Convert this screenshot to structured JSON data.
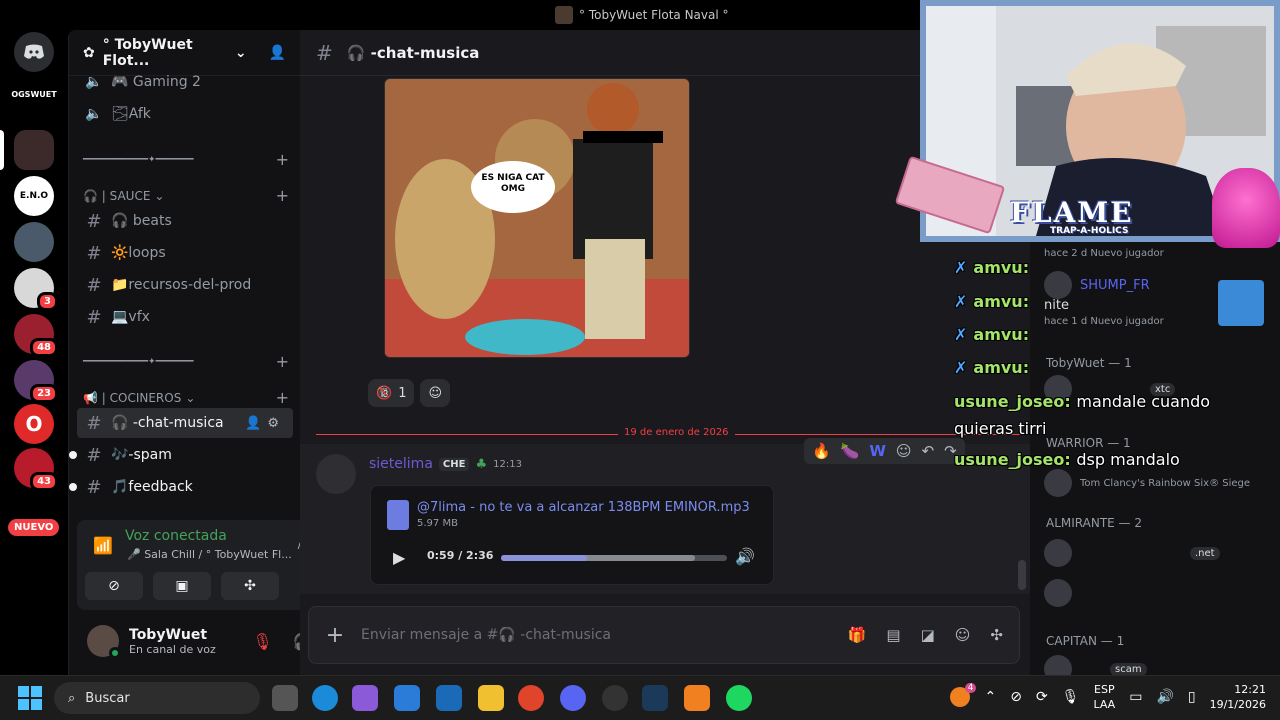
{
  "window": {
    "title": "° TobyWuet Flota Naval °"
  },
  "rail": {
    "servers": [
      {
        "label": "",
        "badge": ""
      },
      {
        "label": "OGSWUET",
        "badge": ""
      },
      {
        "label": "",
        "badge": ""
      },
      {
        "label": "E.N.O",
        "badge": ""
      },
      {
        "label": "",
        "badge": ""
      },
      {
        "label": "",
        "badge": "3"
      },
      {
        "label": "",
        "badge": "48"
      },
      {
        "label": "",
        "badge": "23"
      },
      {
        "label": "O",
        "badge": ""
      },
      {
        "label": "",
        "badge": "43"
      }
    ],
    "new_label": "NUEVO"
  },
  "sidebar": {
    "guild_name": "° TobyWuet Flot...",
    "voice_channels": [
      {
        "name": "🎮 Gaming 2"
      },
      {
        "name": "🌫Afk"
      }
    ],
    "separator": "━━━━━━━━━━━━✦━━━━━━━",
    "sauce_category": "🎧 | SAUCE",
    "sauce_channels": [
      "🎧 beats",
      "🔆loops",
      "📁recursos-del-prod",
      "💻vfx"
    ],
    "cocineros_category": "📢 | COCINEROS",
    "cocineros_channels": [
      "🎧 -chat-musica",
      "🎶-spam",
      "🎵feedback"
    ]
  },
  "voice": {
    "status": "Voz conectada",
    "location": "🎤 Sala Chill / ° TobyWuet Fl..."
  },
  "user": {
    "name": "TobyWuet",
    "status": "En canal de voz"
  },
  "channel": {
    "name": "🎧 -chat-musica"
  },
  "image_text": "ES NIGA CAT OMG",
  "reactions": [
    {
      "emoji": "🔞",
      "count": "1"
    }
  ],
  "date_divider": "19 de enero de 2026",
  "message": {
    "author": "sietelima",
    "tag": "CHE",
    "time": "12:13",
    "file": {
      "name": "@7lima - no te va a alcanzar 138BPM EMINOR.mp3",
      "size": "5.97 MB",
      "time": "0:59 / 2:36",
      "progress": 0.38
    }
  },
  "composer": {
    "placeholder": "Enviar mensaje a #🎧 -chat-musica"
  },
  "members": [
    {
      "group": "",
      "name": "hace 2 d   Nuevo jugador"
    },
    {
      "group": "",
      "name": "SHUMP_FR"
    },
    {
      "group": "",
      "name": "nite"
    },
    {
      "group": "",
      "name": "hace 1 d   Nuevo jugador"
    },
    {
      "group": "TobyWuet — 1",
      "name": ""
    },
    {
      "group": "",
      "name": "xtc"
    },
    {
      "group": "WARRIOR — 1",
      "name": ""
    },
    {
      "group": "",
      "name": "Tom Clancy's Rainbow Six® Siege"
    },
    {
      "group": "ALMIRANTE — 2",
      "name": ".net"
    },
    {
      "group": "CAPITAN — 1",
      "name": "scam"
    }
  ],
  "stream_overlay": {
    "brand": "FLAME",
    "brand_sub": "TRAP-A-HOLICS",
    "chat": [
      {
        "user": "amvu:",
        "text": ""
      },
      {
        "user": "amvu:",
        "text": ""
      },
      {
        "user": "amvu:",
        "text": ""
      },
      {
        "user": "amvu:",
        "text": ""
      },
      {
        "user": "usune_joseo:",
        "text": "mandale cuando"
      },
      {
        "user": "",
        "text": "quieras tirri"
      },
      {
        "user": "usune_joseo:",
        "text": "dsp mandalo"
      }
    ]
  },
  "taskbar": {
    "search": "Buscar",
    "lang1": "ESP",
    "lang2": "LAA",
    "time": "12:21",
    "date": "19/1/2026",
    "notif_badge": "4"
  }
}
